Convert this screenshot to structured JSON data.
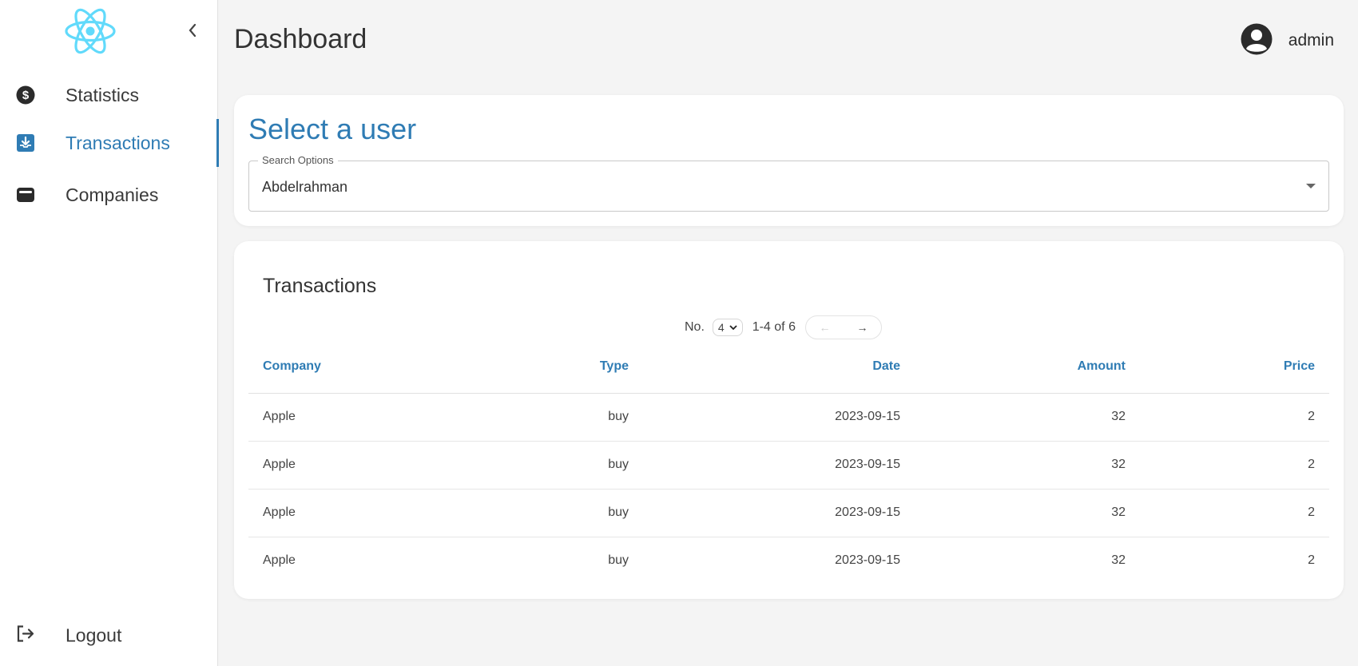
{
  "sidebar": {
    "items": [
      {
        "label": "Statistics",
        "icon": "dollar-circle-icon"
      },
      {
        "label": "Transactions",
        "icon": "inbox-download-icon",
        "active": true
      },
      {
        "label": "Companies",
        "icon": "wallet-icon"
      }
    ],
    "logout_label": "Logout"
  },
  "header": {
    "title": "Dashboard",
    "username": "admin"
  },
  "select_user": {
    "title": "Select a user",
    "field_label": "Search Options",
    "field_value": "Abdelrahman"
  },
  "transactions": {
    "title": "Transactions",
    "pager": {
      "label": "No.",
      "per_page": "4",
      "range": "1-4 of 6",
      "prev": "←",
      "next": "→"
    },
    "columns": [
      "Company",
      "Type",
      "Date",
      "Amount",
      "Price"
    ],
    "rows": [
      [
        "Apple",
        "buy",
        "2023-09-15",
        "32",
        "2"
      ],
      [
        "Apple",
        "buy",
        "2023-09-15",
        "32",
        "2"
      ],
      [
        "Apple",
        "buy",
        "2023-09-15",
        "32",
        "2"
      ],
      [
        "Apple",
        "buy",
        "2023-09-15",
        "32",
        "2"
      ]
    ]
  },
  "colors": {
    "accent": "#2f7cb4",
    "logo": "#61dafb",
    "background": "#f4f4f4"
  }
}
